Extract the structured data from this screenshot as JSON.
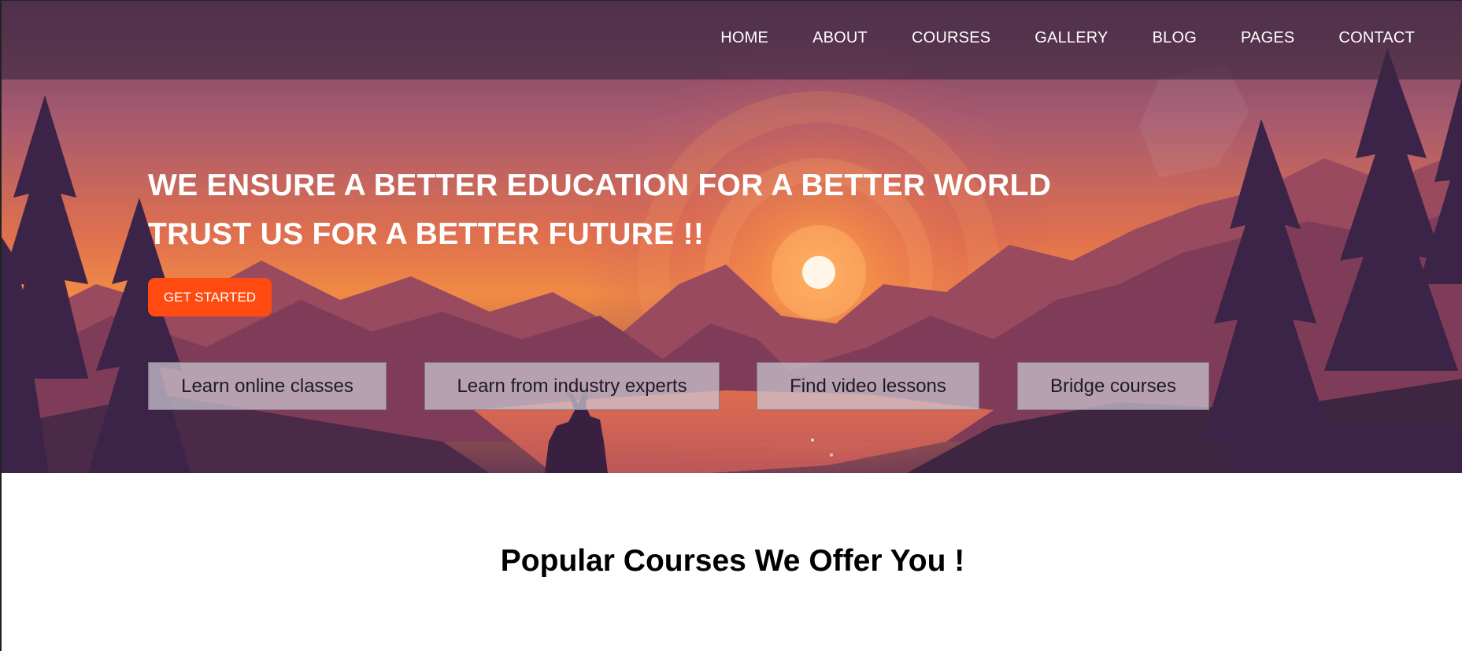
{
  "nav": {
    "items": [
      {
        "label": "HOME"
      },
      {
        "label": "ABOUT"
      },
      {
        "label": "COURSES"
      },
      {
        "label": "GALLERY"
      },
      {
        "label": "BLOG"
      },
      {
        "label": "PAGES"
      },
      {
        "label": "CONTACT"
      }
    ]
  },
  "hero": {
    "title_line1": "WE ENSURE A BETTER EDUCATION FOR A BETTER WORLD",
    "title_line2": "TRUST US FOR A BETTER FUTURE !!",
    "cta_label": "GET STARTED",
    "features": [
      {
        "label": "Learn online classes"
      },
      {
        "label": "Learn from industry experts"
      },
      {
        "label": "Find video lessons"
      },
      {
        "label": "Bridge courses"
      }
    ]
  },
  "courses": {
    "heading": "Popular Courses We Offer You !"
  },
  "colors": {
    "nav_overlay": "#3c263e",
    "cta": "#ff4a12",
    "sky_top": "#8a4a6a",
    "sun_glow": "#f7913f",
    "text_light": "#ffffff"
  }
}
